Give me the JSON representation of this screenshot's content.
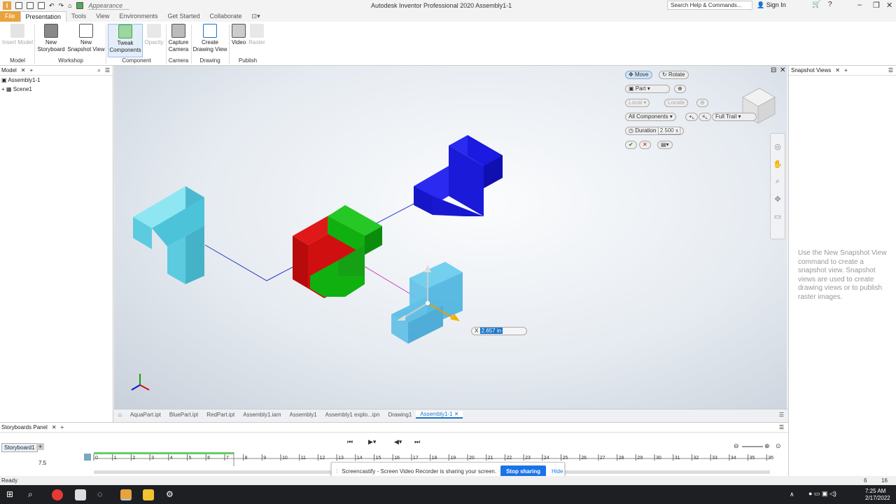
{
  "window": {
    "title": "Autodesk Inventor Professional 2020    Assembly1-1",
    "appearance": "Appearance",
    "search_placeholder": "Search Help & Commands...",
    "sign_in": "Sign In"
  },
  "tabs": [
    "File",
    "Presentation",
    "Tools",
    "View",
    "Environments",
    "Get Started",
    "Collaborate"
  ],
  "ribbon": {
    "buttons": [
      {
        "label": "Insert Model",
        "disabled": true
      },
      {
        "label": "New\nStoryboard"
      },
      {
        "label": "New\nSnapshot View"
      },
      {
        "label": "Tweak\nComponents"
      },
      {
        "label": "Opacity",
        "disabled": true
      },
      {
        "label": "Capture\nCamera"
      },
      {
        "label": "Create\nDrawing View"
      },
      {
        "label": "Video"
      },
      {
        "label": "Raster",
        "disabled": true
      }
    ],
    "groups": [
      "Model",
      "Workshop",
      "Component",
      "Camera",
      "Drawing",
      "Publish"
    ]
  },
  "model_panel": {
    "title": "Model",
    "tree": [
      "Assembly1-1",
      "Scene1"
    ]
  },
  "tweak": {
    "move": "Move",
    "rotate": "Rotate",
    "part": "Part",
    "local": "Local",
    "locate": "Locate",
    "components": "All Components",
    "trail": "Full Trail",
    "duration_label": "Duration",
    "duration_value": "2.500 s",
    "x_label": "X",
    "x_value": "2.657 in"
  },
  "snapshot_panel": {
    "title": "Snapshot Views",
    "message": "Use the New Snapshot View command to create a snapshot view. Snapshot views are used to create drawing views or to publish raster images."
  },
  "doc_tabs": [
    "AquaPart.ipt",
    "BluePart.ipt",
    "RedPart.ipt",
    "Assembly1.iam",
    "Assembly1",
    "Assembly1 explo...ipn",
    "Drawing1",
    "Assembly1-1"
  ],
  "storyboard": {
    "panel_title": "Storyboards Panel",
    "tab": "Storyboard1",
    "time": "7.5",
    "ticks": [
      "0",
      "1",
      "2",
      "3",
      "4",
      "5",
      "6",
      "7",
      "8",
      "9",
      "10",
      "11",
      "12",
      "13",
      "14",
      "15",
      "16",
      "17",
      "18",
      "19",
      "20",
      "21",
      "22",
      "23",
      "24",
      "25",
      "26",
      "27",
      "28",
      "29",
      "30",
      "31",
      "32",
      "33",
      "34",
      "35",
      "36"
    ]
  },
  "share": {
    "text": "Screencastify - Screen Video Recorder is sharing your screen.",
    "stop": "Stop sharing",
    "hide": "Hide"
  },
  "status": {
    "left": "Ready",
    "n1": "6",
    "n2": "16"
  },
  "clock": {
    "time": "7:25 AM",
    "date": "2/17/2022"
  },
  "colors": {
    "aqua": "#5ccbe0",
    "blue": "#1a1ae0",
    "red": "#d01010",
    "green": "#10b010",
    "accent": "#e8a33d",
    "select": "#1a73c8"
  }
}
